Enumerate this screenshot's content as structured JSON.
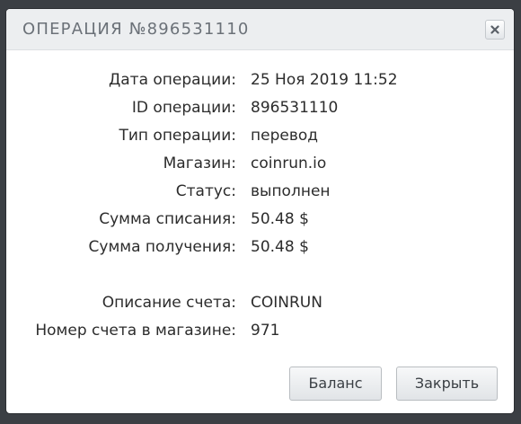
{
  "dialog": {
    "title": "ОПЕРАЦИЯ №896531110",
    "close_icon": "close-icon"
  },
  "details": {
    "date_label": "Дата операции:",
    "date_value": "25 Ноя 2019 11:52",
    "id_label": "ID операции:",
    "id_value": "896531110",
    "type_label": "Тип операции:",
    "type_value": "перевод",
    "shop_label": "Магазин:",
    "shop_value": "coinrun.io",
    "status_label": "Статус:",
    "status_value": "выполнен",
    "debit_label": "Сумма списания:",
    "debit_value": "50.48 $",
    "credit_label": "Сумма получения:",
    "credit_value": "50.48 $",
    "invoice_desc_label": "Описание счета:",
    "invoice_desc_value": "COINRUN",
    "invoice_number_label": "Номер счета в магазине:",
    "invoice_number_value": "971"
  },
  "buttons": {
    "balance": "Баланс",
    "close": "Закрыть"
  },
  "colors": {
    "backdrop": "#3b3f44",
    "titlebar": "#eceef0",
    "title_text": "#6b7178",
    "body_text": "#2c2c2c"
  }
}
